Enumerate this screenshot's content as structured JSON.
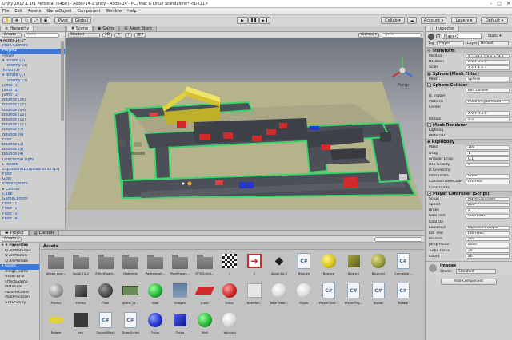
{
  "window": {
    "title": "Unity 2017.1.1f1 Personal (64bit) - Asobi-14-2.unity - Asobi-14 - PC, Mac & Linux Standalone* <DX11>",
    "controls": [
      "–",
      "□",
      "✕"
    ]
  },
  "menu": [
    "File",
    "Edit",
    "Assets",
    "GameObject",
    "Component",
    "Window",
    "Help"
  ],
  "toolbar": {
    "pivot": "Pivot",
    "global": "Global",
    "collab": "Collab ▾",
    "account": "Account ▾",
    "layers": "Layers ▾",
    "layout": "Default ▾"
  },
  "hierarchy": {
    "tab": "Hierarchy",
    "create": "Create ▾",
    "search": "Q▾All",
    "items": [
      {
        "label": "▾ Asobi-14-2*",
        "state": "black"
      },
      {
        "label": "  Main Camera",
        "state": "normal"
      },
      {
        "label": "  Player2",
        "state": "selected"
      },
      {
        "label": "  Player",
        "state": "normal"
      },
      {
        "label": "  ▾ Rotate (2)",
        "state": "normal"
      },
      {
        "label": "      Enemy (3)",
        "state": "normal"
      },
      {
        "label": "  Turbo (1)",
        "state": "normal"
      },
      {
        "label": "  ▾ Rotate (1)",
        "state": "normal"
      },
      {
        "label": "      Enemy (3)",
        "state": "normal"
      },
      {
        "label": "  Jump (3)",
        "state": "normal"
      },
      {
        "label": "  Jump (2)",
        "state": "normal"
      },
      {
        "label": "  Jump (1)",
        "state": "normal"
      },
      {
        "label": "  Bounce (26)",
        "state": "normal"
      },
      {
        "label": "  Bounce (15)",
        "state": "normal"
      },
      {
        "label": "  Bounce (14)",
        "state": "normal"
      },
      {
        "label": "  Bounce (13)",
        "state": "normal"
      },
      {
        "label": "  Bounce (12)",
        "state": "normal"
      },
      {
        "label": "  Bounce (11)",
        "state": "normal"
      },
      {
        "label": "  Bounce (7)",
        "state": "normal"
      },
      {
        "label": "  Bounce (6)",
        "state": "normal"
      },
      {
        "label": "  Floor",
        "state": "normal"
      },
      {
        "label": "  Bounce (2)",
        "state": "normal"
      },
      {
        "label": "  Bounce (3)",
        "state": "normal"
      },
      {
        "label": "  Bounce (4)",
        "state": "normal"
      },
      {
        "label": "  Directional Light",
        "state": "normal"
      },
      {
        "label": "  ▸ Rotate",
        "state": "normal"
      },
      {
        "label": "  Explosion01(Upload to STYLY)",
        "state": "normal"
      },
      {
        "label": "  Floor",
        "state": "normal"
      },
      {
        "label": "  Goal",
        "state": "normal"
      },
      {
        "label": "  EventSystem",
        "state": "normal"
      },
      {
        "label": "  ▸ Canvas",
        "state": "normal"
      },
      {
        "label": "  Cube",
        "state": "normal"
      },
      {
        "label": "  GameControl",
        "state": "normal"
      },
      {
        "label": "  Floor (1)",
        "state": "normal"
      },
      {
        "label": "  Floor (2)",
        "state": "normal"
      },
      {
        "label": "  Floor (3)",
        "state": "normal"
      },
      {
        "label": "  Floor (4)",
        "state": "normal"
      }
    ]
  },
  "scene": {
    "tabs": [
      {
        "label": "# Scene",
        "active": true
      },
      {
        "label": "Game",
        "active": false
      },
      {
        "label": "Asset Store",
        "active": false
      }
    ],
    "shading": "Shaded",
    "mode_2d": "2D",
    "gizmos": "Gizmos ▾",
    "search": "Q▾All",
    "persp": "Persp"
  },
  "inspector": {
    "tab": "Inspector",
    "object_name": "Player2",
    "static_label": "Static ▾",
    "tag_label": "Tag",
    "tag_value": "Player",
    "layer_label": "Layer",
    "layer_value": "Default",
    "sections": {
      "transform": "Transform",
      "mesh_filter": "Sphere (Mesh Filter)",
      "collider": "Sphere Collider",
      "renderer": "Mesh Renderer",
      "rigidbody": "Rigidbody",
      "controller": "Player Controller (Script)"
    },
    "transform_rows": [
      {
        "label": "Position",
        "value": "X -118.2  Y 0.5  Z -3.3"
      },
      {
        "label": "Rotation",
        "value": "X 0  Y 0  Z 0"
      },
      {
        "label": "Scale",
        "value": "X 1  Y 1  Z 1"
      }
    ],
    "mesh_row": {
      "label": "Mesh",
      "value": "Sphere"
    },
    "collider_rows": [
      {
        "label": "",
        "value": "Edit Collider"
      },
      {
        "label": "Is Trigger",
        "value": ""
      },
      {
        "label": "Material",
        "value": "None (Physic Materi"
      },
      {
        "label": "Center",
        "value": ""
      },
      {
        "label": "",
        "value": "X 0   Y 0   Z 0"
      },
      {
        "label": "Radius",
        "value": "0.5"
      }
    ],
    "renderer_rows": [
      {
        "label": "Lighting",
        "value": ""
      },
      {
        "label": "Materials",
        "value": ""
      }
    ],
    "rigidbody_rows": [
      {
        "label": "Mass",
        "value": "100"
      },
      {
        "label": "Drag",
        "value": "1"
      },
      {
        "label": "Angular Drag",
        "value": "0.1"
      },
      {
        "label": "Use Gravity",
        "value": "✔"
      },
      {
        "label": "Is Kinematic",
        "value": ""
      },
      {
        "label": "Interpolate",
        "value": "None"
      },
      {
        "label": "Collision Detection",
        "value": "Discrete"
      },
      {
        "label": "Constraints",
        "value": ""
      }
    ],
    "controller_rows": [
      {
        "label": "Script",
        "value": "PlayerController"
      },
      {
        "label": "Speed",
        "value": "200"
      },
      {
        "label": "Brake",
        "value": "5"
      },
      {
        "label": "Goal Text",
        "value": "Goal (Text)"
      },
      {
        "label": "Goal On",
        "value": ""
      },
      {
        "label": "Explosion",
        "value": "Explosion01(Uplo"
      },
      {
        "label": "Fail Text",
        "value": "Fail (Text)"
      },
      {
        "label": "Bounce",
        "value": "200"
      },
      {
        "label": "Jump Force",
        "value": "4000"
      },
      {
        "label": "Turbo Force",
        "value": "20"
      },
      {
        "label": "Count",
        "value": "20"
      }
    ],
    "material_name": "images",
    "shader_label": "Shader",
    "shader_value": "Standard",
    "add_component": "Add Component"
  },
  "project": {
    "tabs": [
      {
        "label": "Project",
        "active": true
      },
      {
        "label": "Console",
        "active": false
      }
    ],
    "create": "Create ▾",
    "tree": [
      {
        "label": "▾ ★ Favorites",
        "type": "header"
      },
      {
        "label": "   Q All Materials",
        "type": "normal"
      },
      {
        "label": "   Q All Models",
        "type": "normal"
      },
      {
        "label": "   Q All Prefabs",
        "type": "normal"
      },
      {
        "label": "▾ Assets",
        "type": "selected"
      },
      {
        "label": "   Allegs_partic",
        "type": "normal"
      },
      {
        "label": "   Asobi-14-2",
        "type": "normal"
      },
      {
        "label": "   EffectExamp",
        "type": "normal"
      },
      {
        "label": "   Materials",
        "type": "normal"
      },
      {
        "label": "   ParticleCollec",
        "type": "normal"
      },
      {
        "label": "   PostProcessin",
        "type": "normal"
      },
      {
        "label": "   STYLY-Unity",
        "type": "normal"
      }
    ],
    "assets_header": "Assets",
    "assets": [
      {
        "name": "Allegs_part...",
        "kind": "folder"
      },
      {
        "name": "Asobi-14-2",
        "kind": "folder"
      },
      {
        "name": "EffectExam...",
        "kind": "folder"
      },
      {
        "name": "Materials",
        "kind": "folder"
      },
      {
        "name": "Particlecoll...",
        "kind": "folder"
      },
      {
        "name": "PostProces...",
        "kind": "folder"
      },
      {
        "name": "STYLY-Unit...",
        "kind": "folder"
      },
      {
        "name": "1",
        "kind": "checker"
      },
      {
        "name": "2",
        "kind": "arrow"
      },
      {
        "name": "Asobi-14-2",
        "kind": "unity"
      },
      {
        "name": "Bounce",
        "kind": "script"
      },
      {
        "name": "Bounce",
        "kind": "yellow-ball"
      },
      {
        "name": "Bounce",
        "kind": "olive-cube"
      },
      {
        "name": "Bounce2",
        "kind": "olive-ball"
      },
      {
        "name": "Complete...",
        "kind": "script"
      },
      {
        "name": "Enemy",
        "kind": "gray-ball"
      },
      {
        "name": "Enemy",
        "kind": "dark-cube"
      },
      {
        "name": "Floor",
        "kind": "dark-ball"
      },
      {
        "name": "game_st...",
        "kind": "track"
      },
      {
        "name": "Goal",
        "kind": "green-ball"
      },
      {
        "name": "images",
        "kind": "texture"
      },
      {
        "name": "Jump",
        "kind": "red-ramp"
      },
      {
        "name": "Jump",
        "kind": "red-ball"
      },
      {
        "name": "NewMat...",
        "kind": "blank"
      },
      {
        "name": "New Mate...",
        "kind": "white-ball"
      },
      {
        "name": "Player",
        "kind": "white-ball"
      },
      {
        "name": "PlayerCont...",
        "kind": "script"
      },
      {
        "name": "PlayerTrig...",
        "kind": "script"
      },
      {
        "name": "Replay",
        "kind": "script"
      },
      {
        "name": "Rotate",
        "kind": "script"
      },
      {
        "name": "Rotate",
        "kind": "rotate"
      },
      {
        "name": "sky",
        "kind": "dark-tex"
      },
      {
        "name": "SoundEffect",
        "kind": "script"
      },
      {
        "name": "TimerScript",
        "kind": "script"
      },
      {
        "name": "Turbo",
        "kind": "blue-ball"
      },
      {
        "name": "Turbo",
        "kind": "blue-cube"
      },
      {
        "name": "Wall",
        "kind": "green-ball"
      },
      {
        "name": "Yajirushi",
        "kind": "white-ball"
      }
    ]
  },
  "colors": {
    "accent": "#3d78d6",
    "track_green": "#39d66a",
    "track_gray": "#4d4f58",
    "ground": "#b6b48c",
    "ramp_yellow": "#e2d23a",
    "block_red": "#d12a2a",
    "block_blue": "#2536d0"
  }
}
